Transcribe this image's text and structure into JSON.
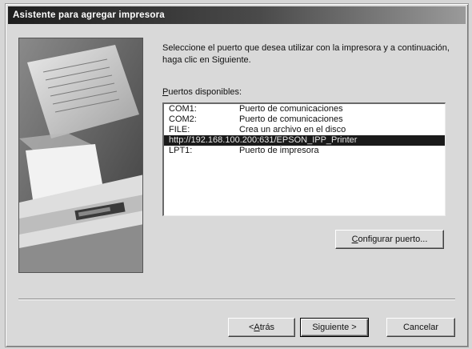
{
  "window": {
    "title": "Asistente para agregar impresora"
  },
  "instruction": "Seleccione el puerto que desea utilizar con la impresora y a continuación, haga clic en Siguiente.",
  "ports_list": {
    "label_underlined": "P",
    "label_rest": "uertos disponibles:",
    "items": [
      {
        "port": "COM1:",
        "description": "Puerto de comunicaciones",
        "selected": false
      },
      {
        "port": "COM2:",
        "description": "Puerto de comunicaciones",
        "selected": false
      },
      {
        "port": "FILE:",
        "description": "Crea un archivo en el disco",
        "selected": false
      },
      {
        "port": "http://192.168.100.200:631/EPSON_IPP_Printer",
        "description": "",
        "selected": true
      },
      {
        "port": "LPT1:",
        "description": "Puerto de impresora",
        "selected": false
      }
    ]
  },
  "buttons": {
    "configure": {
      "underlined": "C",
      "rest": "onfigurar puerto..."
    },
    "back": {
      "prefix": "< ",
      "underlined": "A",
      "rest": "trás"
    },
    "next": {
      "label": "Siguiente >"
    },
    "cancel": {
      "label": "Cancelar"
    }
  }
}
